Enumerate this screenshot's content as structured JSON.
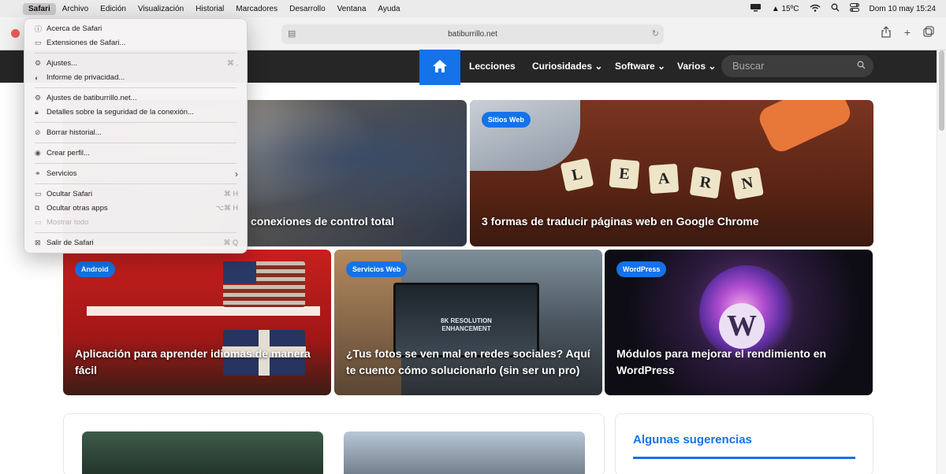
{
  "menubar": {
    "items": [
      "Safari",
      "Archivo",
      "Edición",
      "Visualización",
      "Historial",
      "Marcadores",
      "Desarrollo",
      "Ventana",
      "Ayuda"
    ],
    "weather": "15ºC",
    "datetime": "Dom 10 may 15:24"
  },
  "browser": {
    "url": "batiburrillo.net"
  },
  "site": {
    "nav": [
      "Lecciones",
      "Curiosidades",
      "Software",
      "Varios"
    ],
    "search_placeholder": "Buscar"
  },
  "cards": {
    "c1": {
      "title": "conexiones de control total"
    },
    "c2": {
      "badge": "Sitios Web",
      "title": "3 formas de traducir páginas web en Google Chrome",
      "learn": [
        "L",
        "E",
        "A",
        "R",
        "N"
      ]
    },
    "c3": {
      "badge": "Android",
      "title": "Aplicación para aprender idiomas de manera fácil"
    },
    "c4": {
      "badge": "Servicios Web",
      "title": "¿Tus fotos se ven mal en redes sociales? Aquí te cuento cómo solucionarlo (sin ser un pro)",
      "screen_text": "8K RESOLUTION ENHANCEMENT"
    },
    "c5": {
      "badge": "WordPress",
      "title": "Módulos para mejorar el rendimiento en WordPress"
    }
  },
  "sidebar": {
    "heading": "Algunas sugerencias"
  },
  "safari_menu": {
    "items": [
      {
        "label": "Acerca de Safari",
        "shortcut": "",
        "icon": "info-icon"
      },
      {
        "label": "Extensiones de Safari...",
        "shortcut": "",
        "icon": "extensions-icon"
      },
      {
        "label": "Ajustes...",
        "shortcut": "⌘ ,",
        "icon": "gear-icon"
      },
      {
        "label": "Informe de privacidad...",
        "shortcut": "",
        "icon": "shield-icon"
      },
      {
        "label": "Ajustes de batiburrillo.net...",
        "shortcut": "",
        "icon": "gear-icon"
      },
      {
        "label": "Detalles sobre la seguridad de la conexión...",
        "shortcut": "",
        "icon": "lock-icon"
      },
      {
        "label": "Borrar historial...",
        "shortcut": "",
        "icon": "clear-history-icon"
      },
      {
        "label": "Crear perfil...",
        "shortcut": "",
        "icon": "person-icon"
      },
      {
        "label": "Servicios",
        "shortcut": "›",
        "icon": "services-icon"
      },
      {
        "label": "Ocultar Safari",
        "shortcut": "⌘ H",
        "icon": "window-icon"
      },
      {
        "label": "Ocultar otras apps",
        "shortcut": "⌥⌘ H",
        "icon": "windows-icon"
      },
      {
        "label": "Mostrar todo",
        "shortcut": "",
        "icon": "show-all-icon",
        "disabled": true
      },
      {
        "label": "Salir de Safari",
        "shortcut": "⌘ Q",
        "icon": "quit-icon"
      }
    ]
  }
}
